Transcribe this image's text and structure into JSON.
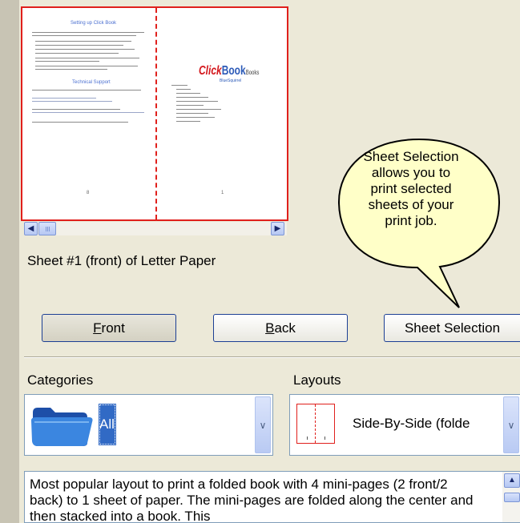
{
  "preview": {
    "left_title": "Setting up Click Book",
    "left_subtitle": "Technical Support",
    "left_page_num": "8",
    "right_page_num": "1",
    "logo_part1": "Click",
    "logo_part2": "Book",
    "logo_part3": "Books",
    "logo_sub": "BlueSquirrel"
  },
  "sheet_label": "Sheet #1 (front) of Letter Paper",
  "callout_text": "Sheet Selection allows you to print selected sheets of your print job.",
  "buttons": {
    "front": "Front",
    "back": "Back",
    "sheet_selection": "Sheet Selection"
  },
  "categories": {
    "label": "Categories",
    "selected": "All",
    "icon": "folder-icon"
  },
  "layouts": {
    "label": "Layouts",
    "selected": "Side-By-Side (folde"
  },
  "description": "Most popular layout to print a folded book with 4 mini-pages (2 front/2 back) to 1 sheet of paper. The mini-pages are folded along the center and then stacked into a book. This",
  "colors": {
    "accent": "#e0201c",
    "selection": "#316ac5",
    "background": "#ECE9D8"
  }
}
